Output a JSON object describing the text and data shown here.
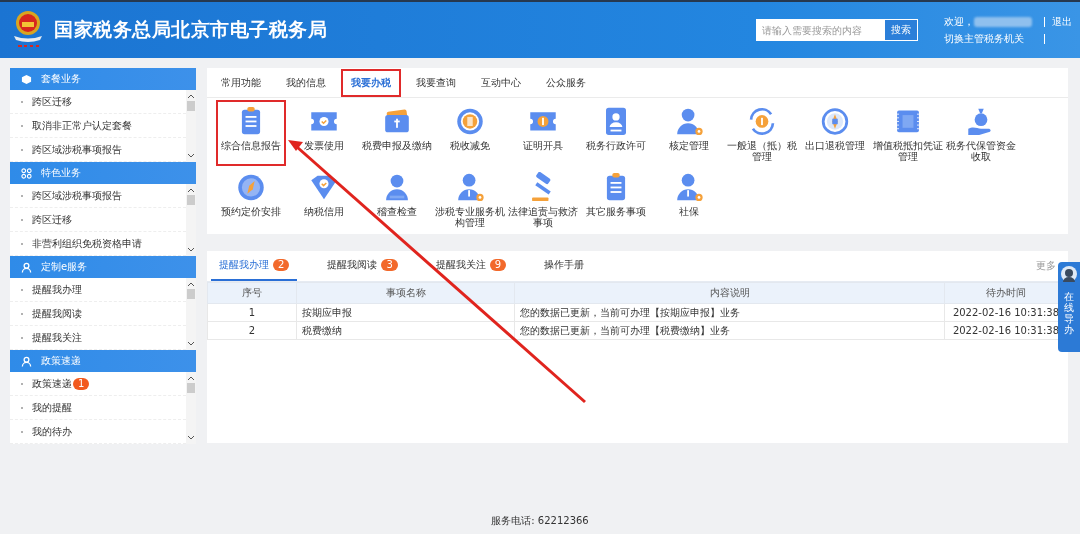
{
  "header": {
    "title": "国家税务总局北京市电子税务局",
    "search": {
      "placeholder": "请输入需要搜索的内容",
      "button": "搜索"
    },
    "welcome": "欢迎，",
    "logout": "退出",
    "switch_authority": "切换主管税务机关"
  },
  "sidebar": {
    "panels": [
      {
        "title": "套餐业务",
        "items": [
          {
            "label": "跨区迁移"
          },
          {
            "label": "取消非正常户认定套餐"
          },
          {
            "label": "跨区域涉税事项报告"
          }
        ]
      },
      {
        "title": "特色业务",
        "items": [
          {
            "label": "跨区域涉税事项报告"
          },
          {
            "label": "跨区迁移"
          },
          {
            "label": "非营利组织免税资格申请"
          }
        ]
      },
      {
        "title": "定制e服务",
        "items": [
          {
            "label": "提醒我办理"
          },
          {
            "label": "提醒我阅读"
          },
          {
            "label": "提醒我关注"
          }
        ]
      },
      {
        "title": "政策速递",
        "items": [
          {
            "label": "政策速递",
            "badge": "1"
          },
          {
            "label": "我的提醒"
          },
          {
            "label": "我的待办"
          }
        ]
      }
    ]
  },
  "services": {
    "tabs": [
      {
        "label": "常用功能",
        "selected": false,
        "highlighted": false
      },
      {
        "label": "我的信息",
        "selected": false,
        "highlighted": false
      },
      {
        "label": "我要办税",
        "selected": true,
        "highlighted": true
      },
      {
        "label": "我要查询",
        "selected": false,
        "highlighted": false
      },
      {
        "label": "互动中心",
        "selected": false,
        "highlighted": false
      },
      {
        "label": "公众服务",
        "selected": false,
        "highlighted": false
      }
    ],
    "items": [
      {
        "label": "综合信息报告",
        "highlighted": true
      },
      {
        "label": "发票使用",
        "highlighted": false
      },
      {
        "label": "税费申报及缴纳",
        "highlighted": false
      },
      {
        "label": "税收减免",
        "highlighted": false
      },
      {
        "label": "证明开具",
        "highlighted": false
      },
      {
        "label": "税务行政许可",
        "highlighted": false
      },
      {
        "label": "核定管理",
        "highlighted": false
      },
      {
        "label": "一般退（抵）税管理",
        "highlighted": false
      },
      {
        "label": "出口退税管理",
        "highlighted": false
      },
      {
        "label": "增值税抵扣凭证管理",
        "highlighted": false
      },
      {
        "label": "税务代保管资金收取",
        "highlighted": false
      },
      {
        "label": "预约定价安排",
        "highlighted": false
      },
      {
        "label": "纳税信用",
        "highlighted": false
      },
      {
        "label": "稽查检查",
        "highlighted": false
      },
      {
        "label": "涉税专业服务机构管理",
        "highlighted": false
      },
      {
        "label": "法律追责与救济事项",
        "highlighted": false
      },
      {
        "label": "其它服务事项",
        "highlighted": false
      },
      {
        "label": "社保",
        "highlighted": false
      }
    ]
  },
  "todos": {
    "tabs": [
      {
        "label": "提醒我办理",
        "count": "2",
        "selected": true
      },
      {
        "label": "提醒我阅读",
        "count": "3",
        "selected": false
      },
      {
        "label": "提醒我关注",
        "count": "9",
        "selected": false
      },
      {
        "label": "操作手册",
        "selected": false
      }
    ],
    "more": "更多",
    "table": {
      "columns": [
        "序号",
        "事项名称",
        "内容说明",
        "待办时间"
      ],
      "rows": [
        [
          "1",
          "按期应申报",
          "您的数据已更新，当前可办理【按期应申报】业务",
          "2022-02-16 10:31:38"
        ],
        [
          "2",
          "税费缴纳",
          "您的数据已更新，当前可办理【税费缴纳】业务",
          "2022-02-16 10:31:38"
        ]
      ]
    }
  },
  "help_widget": {
    "label": "在线导办"
  },
  "footer": {
    "phone": "服务电话: 62212366"
  }
}
